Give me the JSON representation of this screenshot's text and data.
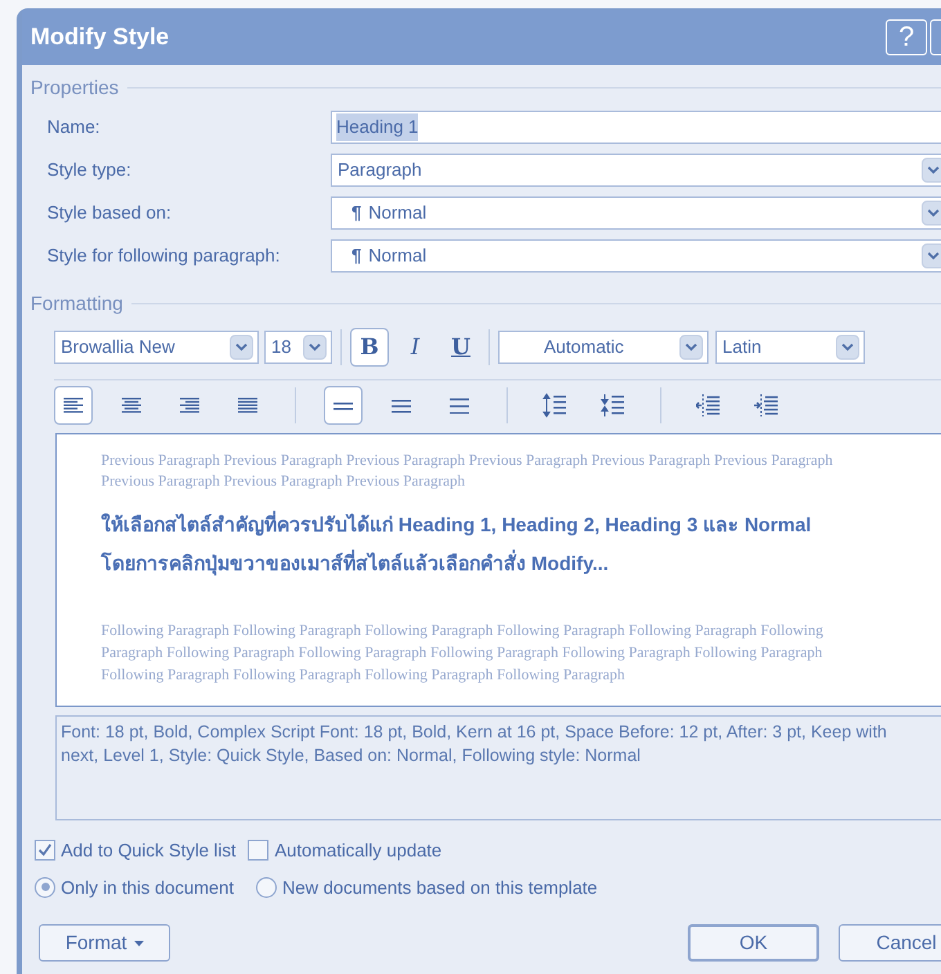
{
  "window": {
    "title": "Modify Style",
    "help": "?"
  },
  "properties": {
    "title": "Properties",
    "fields": [
      {
        "kind": "text",
        "label": "Name:",
        "value": "Heading 1"
      },
      {
        "kind": "dropdown",
        "label": "Style type:",
        "value": "Paragraph"
      },
      {
        "kind": "dropdown",
        "label": "Style based on:",
        "value": "Normal",
        "pilcrow": "¶"
      },
      {
        "kind": "dropdown",
        "label": "Style for following paragraph:",
        "value": "Normal",
        "pilcrow": "¶"
      }
    ]
  },
  "formatting": {
    "title": "Formatting",
    "font": "Browallia New",
    "size": "18",
    "styles": [
      {
        "kind": "bold",
        "label": "B",
        "on": true
      },
      {
        "kind": "italic",
        "label": "I",
        "on": false
      },
      {
        "kind": "underline",
        "label": "U",
        "on": false
      }
    ],
    "color_dropdown": "Automatic",
    "script": "Latin",
    "alignment": [
      {
        "kind": "left",
        "selected": true
      },
      {
        "kind": "center",
        "selected": false
      },
      {
        "kind": "right",
        "selected": false
      },
      {
        "kind": "justify",
        "selected": false
      }
    ],
    "spacing": [
      {
        "kind": "single",
        "selected": true
      },
      {
        "kind": "oneandhalf",
        "selected": false
      },
      {
        "kind": "double",
        "selected": false
      }
    ],
    "paragraph_spacing": [
      {
        "kind": "increase"
      },
      {
        "kind": "decrease"
      }
    ],
    "indent": [
      {
        "kind": "decrease"
      },
      {
        "kind": "increase"
      }
    ]
  },
  "preview": {
    "previous": "Previous Paragraph Previous Paragraph Previous Paragraph Previous Paragraph Previous Paragraph Previous Paragraph Previous Paragraph Previous Paragraph Previous Paragraph",
    "sample_lines": [
      "ให้เลือกสไตล์สำคัญที่ควรปรับได้แก่ Heading 1, Heading 2, Heading 3 และ Normal",
      "โดยการคลิกปุ่มขวาของเมาส์ที่สไตล์แล้วเลือกคำสั่ง Modify..."
    ],
    "following": "Following Paragraph Following Paragraph Following Paragraph Following Paragraph Following Paragraph Following Paragraph Following Paragraph Following Paragraph Following Paragraph Following Paragraph Following Paragraph Following Paragraph Following Paragraph Following Paragraph Following Paragraph"
  },
  "description": "Font: 18 pt, Bold, Complex Script Font: 18 pt, Bold, Kern at 16 pt, Space Before:  12 pt, After:  3 pt, Keep with next, Level 1, Style: Quick Style, Based on: Normal, Following style: Normal",
  "checkboxes": [
    {
      "label": "Add to Quick Style list",
      "checked": true
    },
    {
      "label": "Automatically update",
      "checked": false
    }
  ],
  "radios": [
    {
      "label": "Only in this document",
      "selected": true
    },
    {
      "label": "New documents based on this template",
      "selected": false
    }
  ],
  "buttons": [
    {
      "kind": "menu",
      "label": "Format"
    },
    {
      "kind": "default",
      "label": "OK"
    },
    {
      "kind": "plain",
      "label": "Cancel"
    }
  ]
}
